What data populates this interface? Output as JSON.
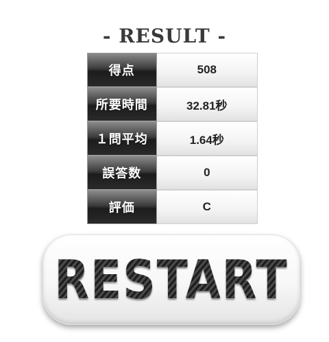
{
  "title": "- RESULT -",
  "rows": [
    {
      "label": "得点",
      "value": "508"
    },
    {
      "label": "所要時間",
      "value": "32.81秒"
    },
    {
      "label": "１問平均",
      "value": "1.64秒"
    },
    {
      "label": "誤答数",
      "value": "0"
    },
    {
      "label": "評価",
      "value": "C"
    }
  ],
  "restart_label": "RESTART"
}
